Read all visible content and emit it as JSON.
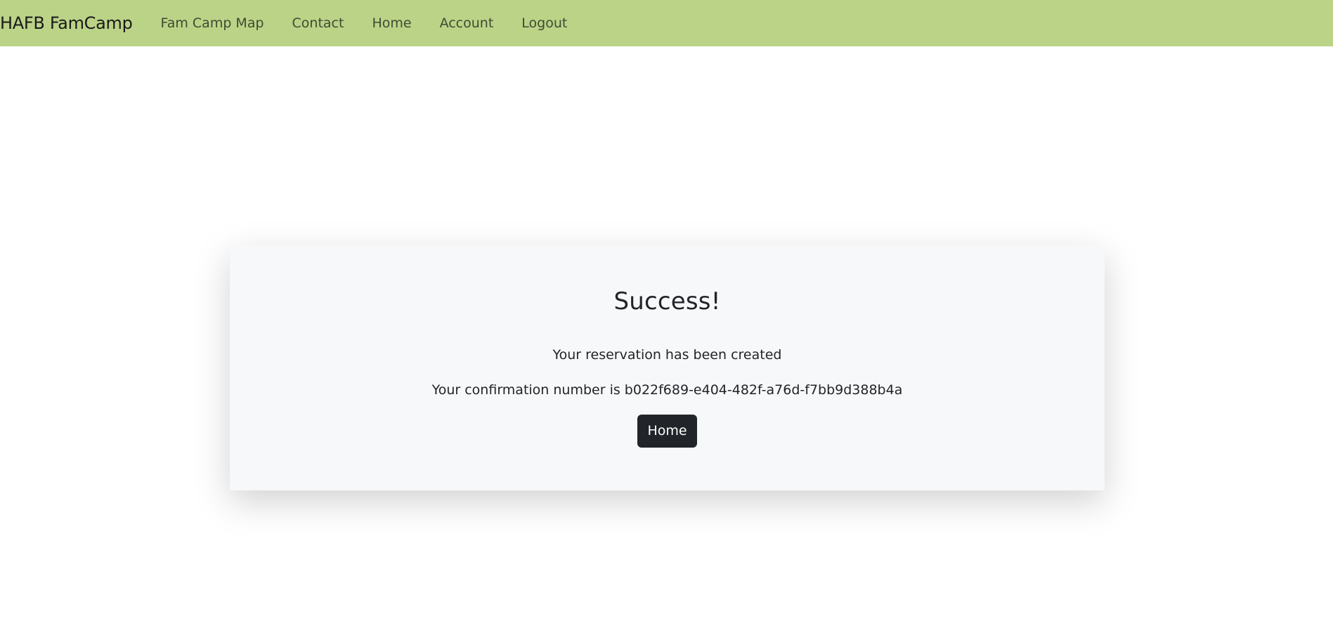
{
  "navbar": {
    "brand": "HAFB FamCamp",
    "links": [
      {
        "label": "Fam Camp Map"
      },
      {
        "label": "Contact"
      },
      {
        "label": "Home"
      },
      {
        "label": "Account"
      },
      {
        "label": "Logout"
      }
    ],
    "background_color": "#bbd387"
  },
  "card": {
    "title": "Success!",
    "message": "Your reservation has been created",
    "confirmation_text": "Your confirmation number is b022f689-e404-482f-a76d-f7bb9d388b4a",
    "button_label": "Home"
  }
}
